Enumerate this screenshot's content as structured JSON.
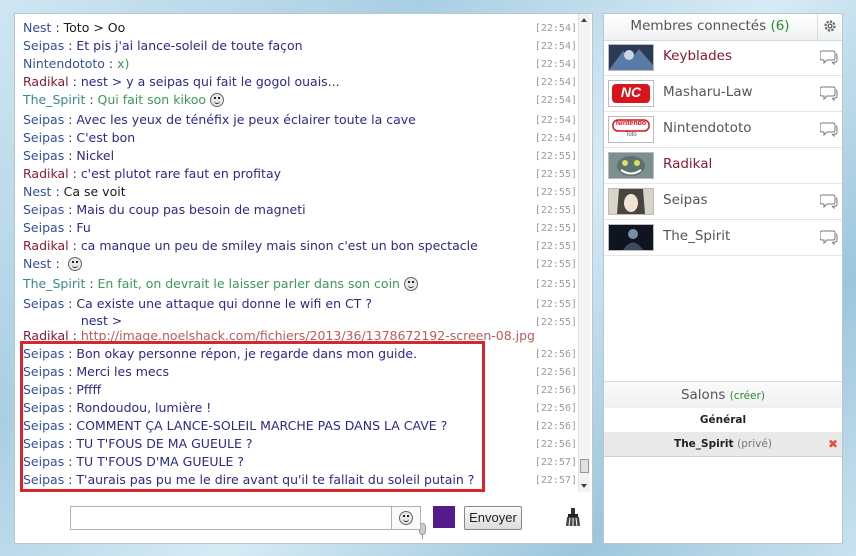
{
  "chat": {
    "messages": [
      {
        "nick": "Nest",
        "nick_color": "blue",
        "text": "Toto > Oo",
        "text_color": "dark",
        "time": "[22:54]"
      },
      {
        "nick": "Seipas",
        "nick_color": "blue",
        "text": "Et pis j'ai lance-soleil de toute façon",
        "text_color": "purple",
        "time": "[22:54]"
      },
      {
        "nick": "Nintendototo",
        "nick_color": "blue",
        "text": "x)",
        "text_color": "green",
        "time": "[22:54]"
      },
      {
        "nick": "Radikal",
        "nick_color": "red",
        "text": "nest > y a seipas qui fait le gogol ouais...",
        "text_color": "purple",
        "time": "[22:54]"
      },
      {
        "nick": "The_Spirit",
        "nick_color": "green",
        "text": "Qui fait son kikoo",
        "text_color": "green",
        "time": "[22:54]",
        "smiley": true
      },
      {
        "nick": "Seipas",
        "nick_color": "blue",
        "text": "Avec les yeux de ténéfix je peux éclairer toute la cave",
        "text_color": "purple",
        "time": "[22:54]"
      },
      {
        "nick": "Seipas",
        "nick_color": "blue",
        "text": "C'est bon",
        "text_color": "purple",
        "time": "[22:54]"
      },
      {
        "nick": "Seipas",
        "nick_color": "blue",
        "text": "Nickel",
        "text_color": "purple",
        "time": "[22:55]"
      },
      {
        "nick": "Radikal",
        "nick_color": "red",
        "text": "c'est plutot rare faut en profitay",
        "text_color": "purple",
        "time": "[22:55]"
      },
      {
        "nick": "Nest",
        "nick_color": "blue",
        "text": "Ca se voit",
        "text_color": "dark",
        "time": "[22:55]"
      },
      {
        "nick": "Seipas",
        "nick_color": "blue",
        "text": "Mais du coup pas besoin de magneti",
        "text_color": "purple",
        "time": "[22:55]"
      },
      {
        "nick": "Seipas",
        "nick_color": "blue",
        "text": "Fu",
        "text_color": "purple",
        "time": "[22:55]"
      },
      {
        "nick": "Radikal",
        "nick_color": "red",
        "text": "ca manque un peu de smiley mais sinon c'est un bon spectacle",
        "text_color": "purple",
        "time": "[22:55]"
      },
      {
        "nick": "Nest",
        "nick_color": "blue",
        "text": "",
        "text_color": "dark",
        "time": "[22:55]",
        "smiley": true
      },
      {
        "nick": "The_Spirit",
        "nick_color": "green",
        "text": "En fait, on devrait le laisser parler dans son coin",
        "text_color": "green",
        "time": "[22:55]",
        "smiley": true
      },
      {
        "nick": "Seipas",
        "nick_color": "blue",
        "text": "Ca existe une attaque qui donne le wifi en CT ?",
        "text_color": "purple",
        "time": "[22:55]"
      },
      {
        "nick": "Radikal",
        "nick_color": "red",
        "text_prefix": "nest > ",
        "text": "http://image.noelshack.com/fichiers/2013/36/1378672192-screen-08.jpg",
        "text_color": "link",
        "time": "[22:55]",
        "wrap": true
      },
      {
        "nick": "Seipas",
        "nick_color": "blue",
        "text": "Bon okay personne répon, je regarde dans mon guide.",
        "text_color": "purple",
        "time": "[22:56]"
      },
      {
        "nick": "Seipas",
        "nick_color": "blue",
        "text": "Merci les mecs",
        "text_color": "purple",
        "time": "[22:56]"
      },
      {
        "nick": "Seipas",
        "nick_color": "blue",
        "text": "Pffff",
        "text_color": "purple",
        "time": "[22:56]"
      },
      {
        "nick": "Seipas",
        "nick_color": "blue",
        "text": "Rondoudou, lumière !",
        "text_color": "purple",
        "time": "[22:56]"
      },
      {
        "nick": "Seipas",
        "nick_color": "blue",
        "text": "COMMENT ÇA LANCE-SOLEIL MARCHE PAS DANS LA CAVE ?",
        "text_color": "purple",
        "time": "[22:56]"
      },
      {
        "nick": "Seipas",
        "nick_color": "blue",
        "text": "TU T'FOUS DE MA GUEULE ?",
        "text_color": "purple",
        "time": "[22:56]"
      },
      {
        "nick": "Seipas",
        "nick_color": "blue",
        "text": "TU T'FOUS D'MA GUEULE ?",
        "text_color": "purple",
        "time": "[22:57]"
      },
      {
        "nick": "Seipas",
        "nick_color": "blue",
        "text": "T'aurais pas pu me le dire avant qu'il te fallait du soleil putain ?",
        "text_color": "purple",
        "time": "[22:57]"
      }
    ],
    "input_value": "",
    "send_label": "Envoyer",
    "text_color_swatch": "#551a8b"
  },
  "sidebar": {
    "members_title": "Membres connectés",
    "members_count": "(6)",
    "members": [
      {
        "name": "Keyblades",
        "color": "red",
        "bubble": true,
        "avatar": "keyblades"
      },
      {
        "name": "Masharu-Law",
        "color": "grey",
        "bubble": true,
        "avatar": "nc-logo",
        "avatar_text": "NC"
      },
      {
        "name": "Nintendototo",
        "color": "grey",
        "bubble": true,
        "avatar": "nintendo-logo",
        "avatar_text": "Nintendo",
        "avatar_sub": "Toto"
      },
      {
        "name": "Radikal",
        "color": "red",
        "bubble": false,
        "avatar": "cheshire-cat"
      },
      {
        "name": "Seipas",
        "color": "grey",
        "bubble": true,
        "avatar": "anime"
      },
      {
        "name": "The_Spirit",
        "color": "grey",
        "bubble": true,
        "avatar": "dark-figure"
      }
    ],
    "salons_title": "Salons",
    "salons_create": "(créer)",
    "salons": [
      {
        "name": "Général",
        "tag": ""
      },
      {
        "name": "The_Spirit",
        "tag": "(privé)"
      }
    ]
  }
}
